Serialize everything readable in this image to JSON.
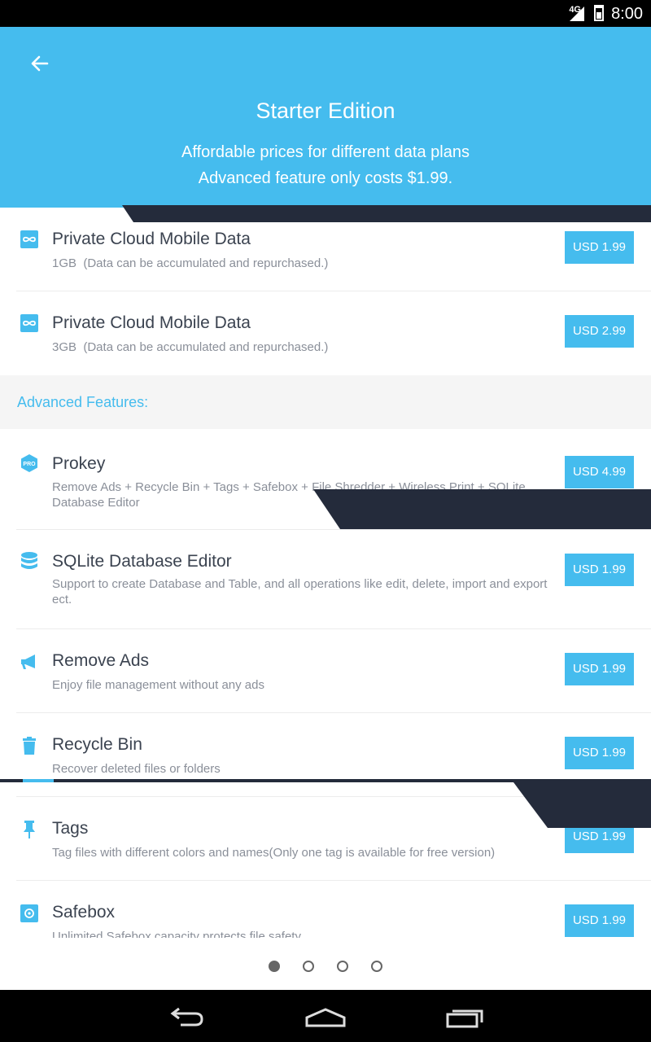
{
  "status_bar": {
    "network": "4G",
    "time": "8:00"
  },
  "header": {
    "title": "Starter Edition",
    "subtitle_line1": "Affordable prices for different data plans",
    "subtitle_line2": "Advanced feature only costs $1.99."
  },
  "data_plans": [
    {
      "icon": "cloud-infinity-icon",
      "title": "Private Cloud Mobile Data",
      "size": "1GB",
      "note": "(Data can be accumulated and repurchased.)",
      "price": "USD 1.99"
    },
    {
      "icon": "cloud-infinity-icon",
      "title": "Private Cloud Mobile Data",
      "size": "3GB",
      "note": "(Data can be accumulated and repurchased.)",
      "price": "USD 2.99"
    }
  ],
  "section_title": "Advanced Features:",
  "features": [
    {
      "icon": "pro-badge-icon",
      "title": "Prokey",
      "desc": "Remove Ads + Recycle Bin + Tags + Safebox + File Shredder + Wireless Print + SQLite Database Editor",
      "price": "USD 4.99"
    },
    {
      "icon": "database-icon",
      "title": "SQLite Database Editor",
      "desc": "Support to create Database and Table, and all operations like edit, delete, import and export ect.",
      "price": "USD 1.99"
    },
    {
      "icon": "megaphone-icon",
      "title": "Remove Ads",
      "desc": "Enjoy file management without any ads",
      "price": "USD 1.99"
    },
    {
      "icon": "trash-icon",
      "title": "Recycle Bin",
      "desc": "Recover deleted files or folders",
      "price": "USD 1.99"
    },
    {
      "icon": "pin-icon",
      "title": "Tags",
      "desc": "Tag files with different colors and names(Only one tag is available for free version)",
      "price": "USD 1.99"
    },
    {
      "icon": "safebox-icon",
      "title": "Safebox",
      "desc": "Unlimited Safebox capacity protects file safety",
      "price": "USD 1.99"
    }
  ],
  "pager": {
    "page_count": 4,
    "active_index": 0
  },
  "colors": {
    "accent": "#45bcee",
    "dark_band": "#242b3b"
  }
}
